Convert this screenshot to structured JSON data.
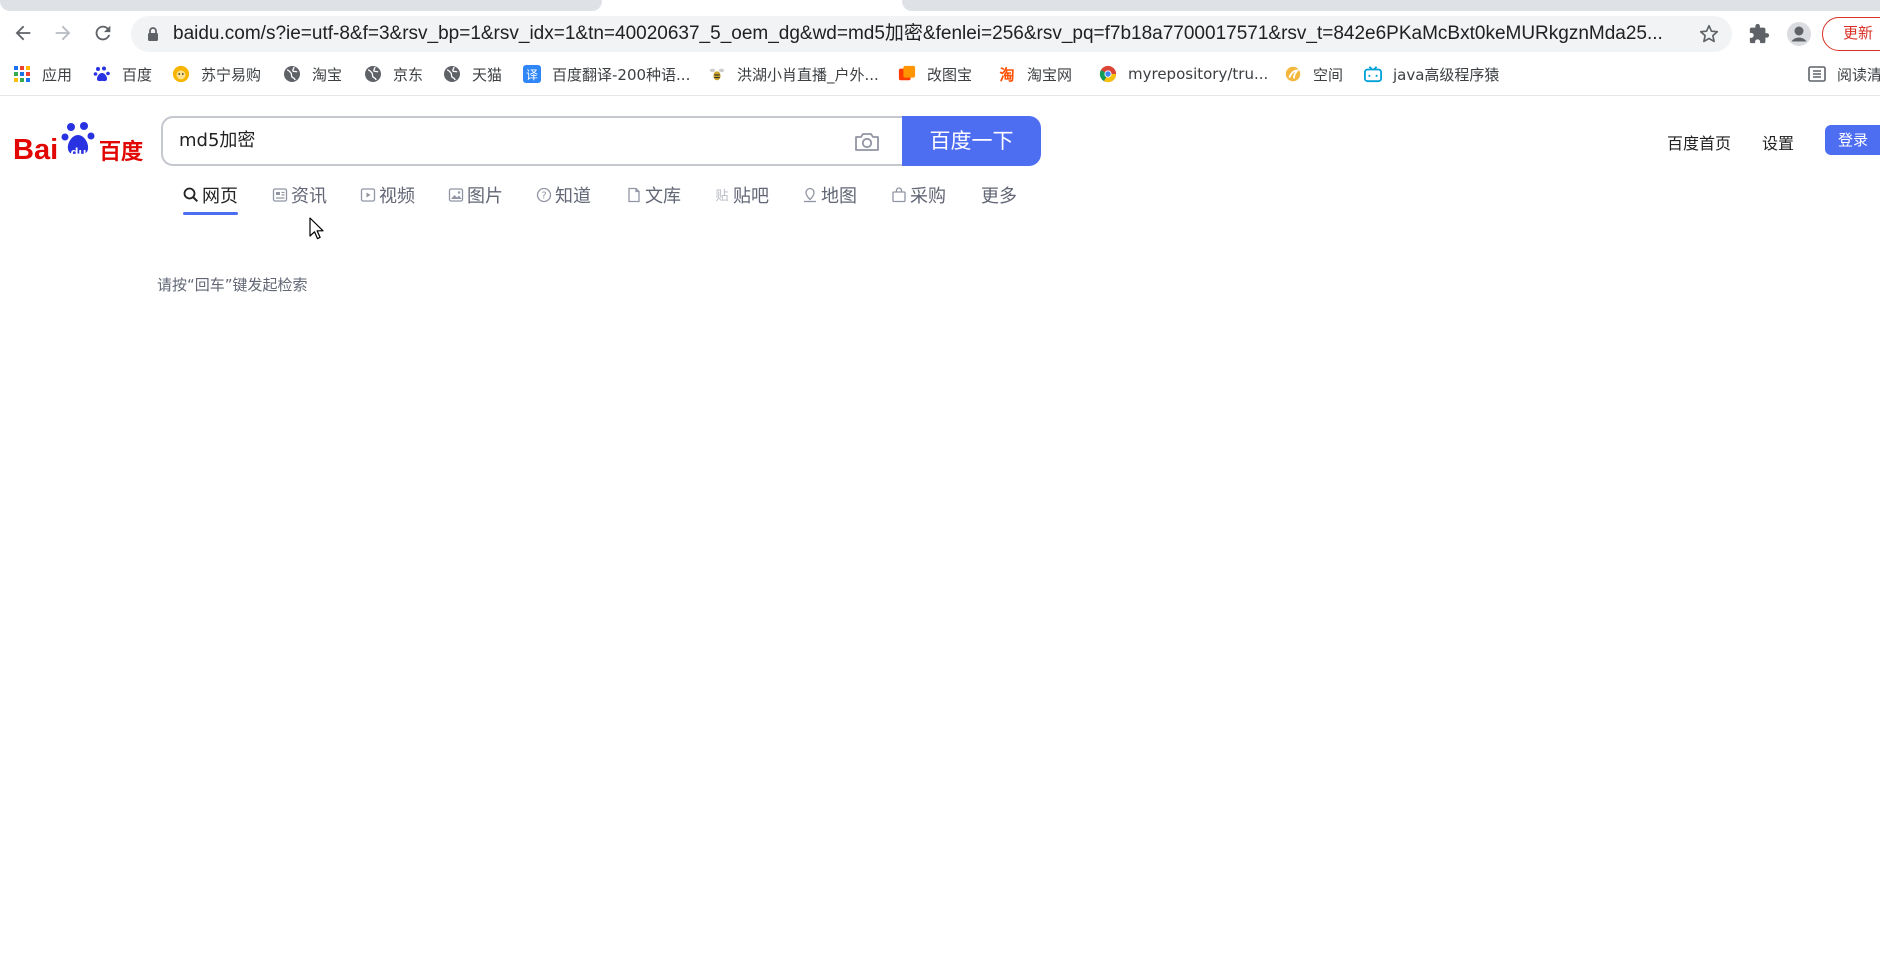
{
  "browser": {
    "url": "baidu.com/s?ie=utf-8&f=3&rsv_bp=1&rsv_idx=1&tn=40020637_5_oem_dg&wd=md5加密&fenlei=256&rsv_pq=f7b18a7700017571&rsv_t=842e6PKaMcBxt0keMURkgznMda25...",
    "update_label": "更新",
    "accent_color": "#d93025"
  },
  "bookmarks": [
    {
      "label": "应用",
      "icon": "apps-grid-icon"
    },
    {
      "label": "百度",
      "icon": "baidu-paw-icon"
    },
    {
      "label": "苏宁易购",
      "icon": "suning-lion-icon"
    },
    {
      "label": "淘宝",
      "icon": "globe-icon"
    },
    {
      "label": "京东",
      "icon": "globe-icon"
    },
    {
      "label": "天猫",
      "icon": "globe-icon"
    },
    {
      "label": "百度翻译-200种语...",
      "icon": "translate-icon"
    },
    {
      "label": "洪湖小肖直播_户外...",
      "icon": "bee-icon"
    },
    {
      "label": "改图宝",
      "icon": "gaitubao-icon"
    },
    {
      "label": "淘宝网",
      "icon": "taobao-icon"
    },
    {
      "label": "myrepository/tru...",
      "icon": "chrome-icon"
    },
    {
      "label": "空间",
      "icon": "qzone-icon"
    },
    {
      "label": "java高级程序猿",
      "icon": "bilibili-icon"
    },
    {
      "label": "阅读清",
      "icon": "reading-list-icon"
    }
  ],
  "page": {
    "search_value": "md5加密",
    "search_button": "百度一下",
    "links": {
      "home": "百度首页",
      "settings": "设置",
      "login": "登录"
    },
    "tabs": [
      {
        "label": "网页",
        "icon": "search-icon",
        "active": true
      },
      {
        "label": "资讯",
        "icon": "news-icon"
      },
      {
        "label": "视频",
        "icon": "video-icon"
      },
      {
        "label": "图片",
        "icon": "image-icon"
      },
      {
        "label": "知道",
        "icon": "question-icon"
      },
      {
        "label": "文库",
        "icon": "doc-icon"
      },
      {
        "label": "贴吧",
        "icon": "tieba-icon"
      },
      {
        "label": "地图",
        "icon": "map-icon"
      },
      {
        "label": "采购",
        "icon": "cart-icon"
      },
      {
        "label": "更多",
        "icon": ""
      }
    ],
    "hint": "请按“回车”键发起检索",
    "brand_color": "#4e6ef2"
  }
}
